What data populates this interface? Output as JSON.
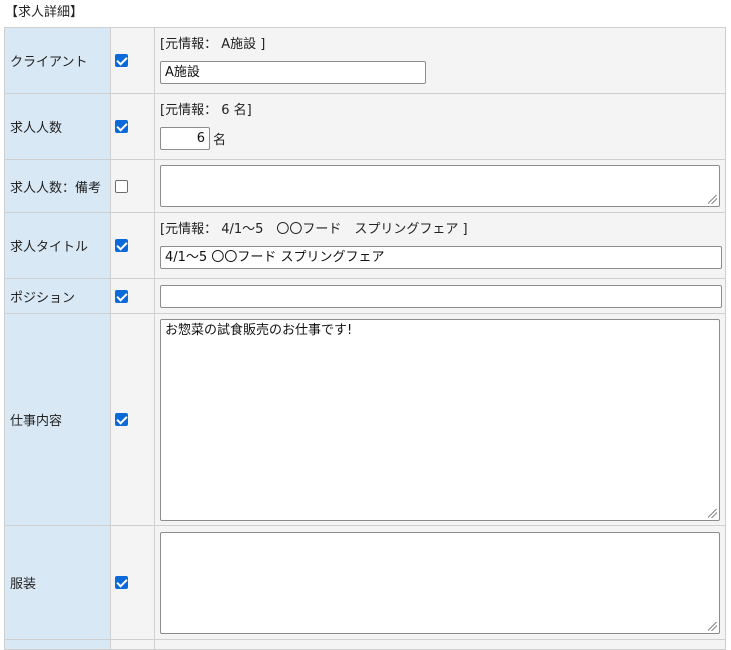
{
  "section": {
    "title": "【求人詳細】"
  },
  "rows": [
    {
      "label": "クライアント",
      "checked": true,
      "original": "[元情報： A施設 ]",
      "value": "A施設"
    },
    {
      "label": "求人人数",
      "checked": true,
      "original": "[元情報： 6 名]",
      "value": "6",
      "unit": "名"
    },
    {
      "label": "求人人数：備考",
      "checked": false,
      "value": ""
    },
    {
      "label": "求人タイトル",
      "checked": true,
      "original": "[元情報： 4/1～5　〇〇フード　スプリングフェア ]",
      "value": "4/1～5 〇〇フード スプリングフェア"
    },
    {
      "label": "ポジション",
      "checked": true,
      "value": ""
    },
    {
      "label": "仕事内容",
      "checked": true,
      "value": "お惣菜の試食販売のお仕事です!"
    },
    {
      "label": "服装",
      "checked": true,
      "value": ""
    }
  ],
  "colors": {
    "label_bg": "#d9e8f5",
    "cell_bg": "#f4f4f4",
    "checkbox_blue": "#0b6ad8",
    "border": "#cfcfcf"
  }
}
